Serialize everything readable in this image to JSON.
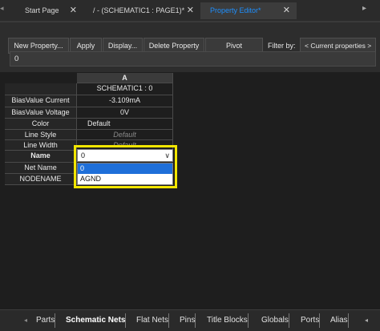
{
  "doc_tabs": [
    {
      "label": "Start Page",
      "close": "✕"
    },
    {
      "label": "/ - (SCHEMATIC1 : PAGE1)*",
      "close": "✕"
    },
    {
      "label": "Property Editor*",
      "close": "✕"
    }
  ],
  "toolbar": {
    "new_property": "New Property...",
    "apply": "Apply",
    "display": "Display...",
    "delete_property": "Delete Property",
    "pivot": "Pivot",
    "filter_label": "Filter by:",
    "filter_value": "< Current properties >"
  },
  "value_bar": "0",
  "grid": {
    "column_header": "A",
    "rows": [
      {
        "label": "",
        "value": "SCHEMATIC1 : 0"
      },
      {
        "label": "BiasValue Current",
        "value": "-3.109mA"
      },
      {
        "label": "BiasValue Voltage",
        "value": "0V"
      },
      {
        "label": "Color",
        "value": "Default"
      },
      {
        "label": "Line Style",
        "value": "Default"
      },
      {
        "label": "Line Width",
        "value": "Default"
      },
      {
        "label": "Name",
        "value": ""
      },
      {
        "label": "Net Name",
        "value": ""
      },
      {
        "label": "NODENAME",
        "value": ""
      }
    ]
  },
  "dropdown": {
    "value": "0",
    "options": [
      "0",
      "AGND"
    ],
    "selected_index": 0
  },
  "bottom_tabs": [
    "Parts",
    "Schematic Nets",
    "Flat Nets",
    "Pins",
    "Title Blocks",
    "Globals",
    "Ports",
    "Alias"
  ],
  "bottom_active": "Schematic Nets",
  "colors": {
    "background": "#1e1e1e",
    "active_tab_text": "#1e90ff",
    "highlight": "#f2e600",
    "selection": "#1e6fd9"
  }
}
